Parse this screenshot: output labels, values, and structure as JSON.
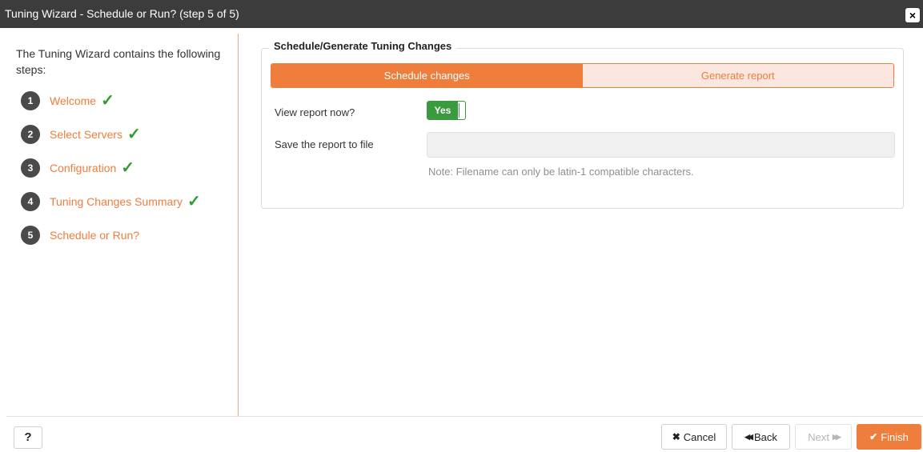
{
  "window": {
    "title": "Tuning Wizard - Schedule or Run? (step 5 of 5)",
    "close_icon": "×"
  },
  "sidebar": {
    "intro": "The Tuning Wizard contains the following steps:",
    "steps": [
      {
        "number": "1",
        "label": "Welcome",
        "check": "✓"
      },
      {
        "number": "2",
        "label": "Select Servers",
        "check": "✓"
      },
      {
        "number": "3",
        "label": "Configuration",
        "check": "✓"
      },
      {
        "number": "4",
        "label": "Tuning Changes Summary",
        "check": "✓"
      },
      {
        "number": "5",
        "label": "Schedule or Run?"
      }
    ]
  },
  "main": {
    "section_title": "Schedule/Generate Tuning Changes",
    "tabs": [
      {
        "label": "Schedule changes",
        "active": true
      },
      {
        "label": "Generate report",
        "active": false
      }
    ],
    "view_report_label": "View report now?",
    "view_report_toggle": "Yes",
    "save_report_label": "Save the report to file",
    "save_report_value": "",
    "note": "Note: Filename can only be latin-1 compatible characters."
  },
  "footer": {
    "help_label": "?",
    "cancel_icon": "✖",
    "cancel_label": "Cancel",
    "back_icon": "◀◀",
    "back_label": "Back",
    "next_label": "Next",
    "next_icon": "▶▶",
    "finish_icon": "✔",
    "finish_label": "Finish"
  },
  "colors": {
    "accent": "#ef7d3c",
    "titlebar": "#3c3c3c",
    "toggle_on": "#3a9a3e",
    "check": "#2e9e2e"
  }
}
